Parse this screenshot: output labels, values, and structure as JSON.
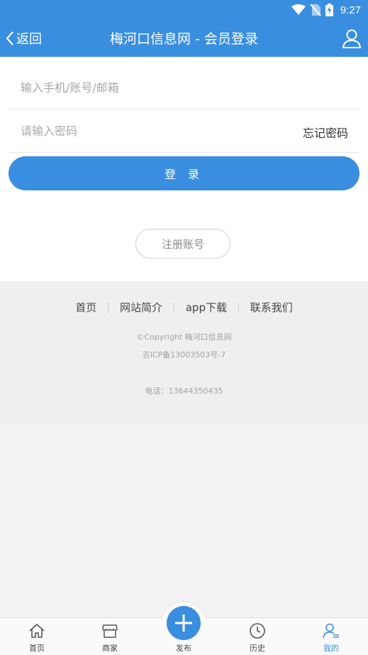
{
  "status": {
    "time": "9:27"
  },
  "header": {
    "back_label": "返回",
    "title": "梅河口信息网 - 会员登录"
  },
  "form": {
    "account_placeholder": "输入手机/账号/邮箱",
    "password_placeholder": "请输入密码",
    "forgot_label": "忘记密码",
    "login_label": "登 录",
    "register_label": "注册账号"
  },
  "footer": {
    "links": [
      "首页",
      "网站简介",
      "app下载",
      "联系我们"
    ],
    "copyright": "©Copyright  梅河口信息网",
    "icp": "吉ICP备13003503号-7",
    "phone": "电话：13644350435"
  },
  "tabbar": {
    "items": [
      {
        "label": "首页",
        "icon": "home-icon"
      },
      {
        "label": "商家",
        "icon": "store-icon"
      },
      {
        "label": "发布",
        "icon": "plus-icon"
      },
      {
        "label": "历史",
        "icon": "clock-icon"
      },
      {
        "label": "我的",
        "icon": "user-icon"
      }
    ],
    "active_index": 4
  },
  "colors": {
    "primary": "#3a8ee0",
    "background": "#f2f2f2"
  }
}
